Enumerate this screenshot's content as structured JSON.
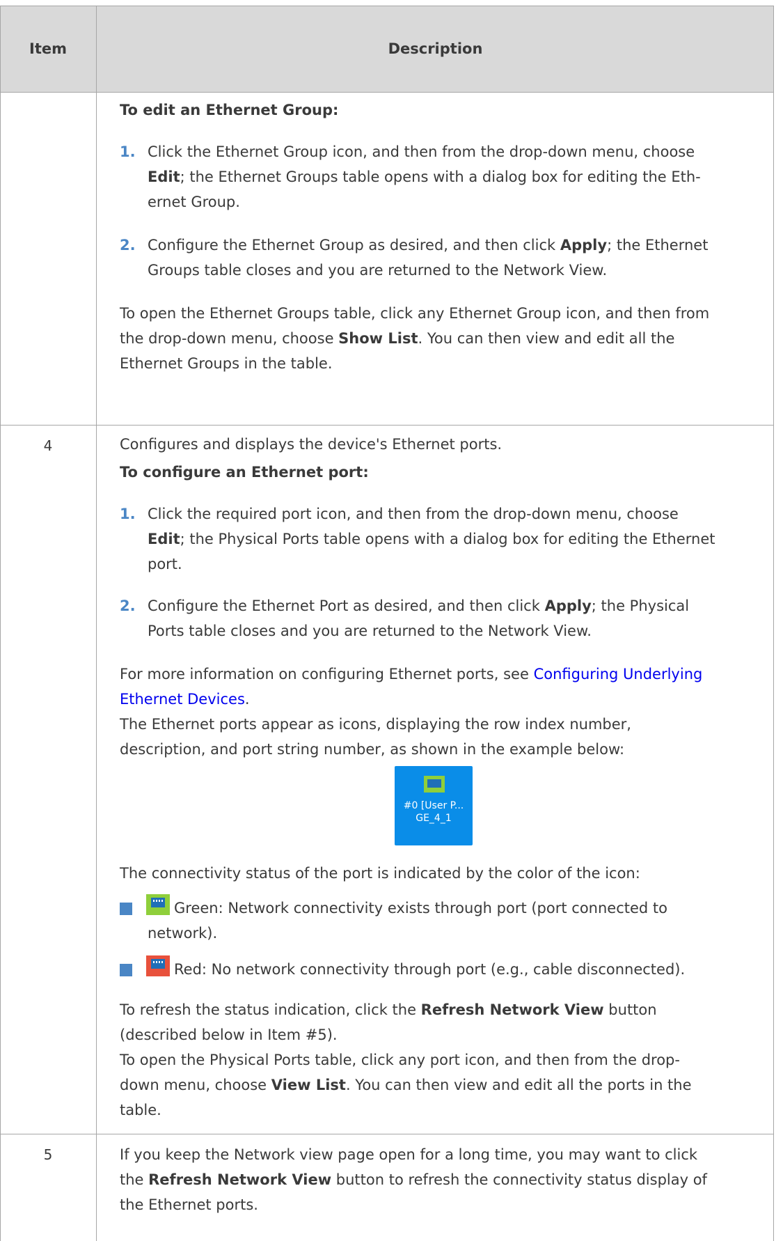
{
  "header": {
    "item": "Item",
    "description": "Description"
  },
  "row3": {
    "heading_edit": "To edit an Ethernet Group:",
    "step1": {
      "num": "1.",
      "l1": "Click the Ethernet Group icon, and then from the drop-down menu, choose",
      "l2_b": "Edit",
      "l2": "; the Ethernet Groups table opens with a dialog box for editing the Eth-",
      "l3": "ernet Group."
    },
    "step2": {
      "num": "2.",
      "l1a": "Configure the Ethernet Group as desired, and then click ",
      "l1_b": "Apply",
      "l1b": "; the Ethernet",
      "l2": "Groups table closes and you are returned to the Network View."
    },
    "para": {
      "l1": "To open the Ethernet Groups table, click any Ethernet Group icon, and then from",
      "l2a": "the drop-down menu, choose ",
      "l2_b": "Show List",
      "l2b": ". You can then view and edit all the",
      "l3": "Ethernet Groups in the table."
    }
  },
  "row4": {
    "item": "4",
    "intro": "Configures and displays the device's Ethernet ports.",
    "heading_config": "To configure an Ethernet port:",
    "step1": {
      "num": "1.",
      "l1": "Click the required port icon, and then from the drop-down menu, choose",
      "l2_b": "Edit",
      "l2": "; the Physical Ports table opens with a dialog box for editing the Ethernet",
      "l3": "port."
    },
    "step2": {
      "num": "2.",
      "l1a": "Configure the Ethernet Port as desired, and then click ",
      "l1_b": "Apply",
      "l1b": "; the Physical",
      "l2": "Ports table closes and you are returned to the Network View."
    },
    "more_info": {
      "l1a": "For more information on configuring Ethernet ports, see ",
      "link1": "Configuring Underlying",
      "link2": "Ethernet Devices",
      "l2b": "."
    },
    "appear": {
      "l1": "The Ethernet ports appear as icons, displaying the row index number,",
      "l2": "description, and port string number, as shown in the example below:"
    },
    "port_icon": {
      "line1": "#0 [User P...",
      "line2": "GE_4_1",
      "icon": "ethernet-port-icon",
      "color": "#0a8de8"
    },
    "status_intro": "The connectivity status of the port is indicated by the color of the icon:",
    "green": {
      "l1": "Green: Network connectivity exists through port (port connected to",
      "l2": "network).",
      "color": "#8fcf3b"
    },
    "red": {
      "l1": "Red: No network connectivity through port (e.g., cable disconnected).",
      "color": "#e8513c"
    },
    "refresh": {
      "l1a": "To refresh the status indication, click the ",
      "l1_b": "Refresh Network View",
      "l1b": " button",
      "l2": "(described below in Item #5)."
    },
    "open_list": {
      "l1": "To open the Physical Ports table, click any port icon, and then from the drop-",
      "l2a": "down menu, choose ",
      "l2_b": "View List",
      "l2b": ". You can then view and edit all the ports in the",
      "l3": "table."
    }
  },
  "row5": {
    "item": "5",
    "l1": "If you keep the Network view page open for a long time, you may want to click",
    "l2a": "the ",
    "l2_b": "Refresh Network View",
    "l2b": " button to refresh the connectivity status display of",
    "l3": "the Ethernet ports."
  }
}
